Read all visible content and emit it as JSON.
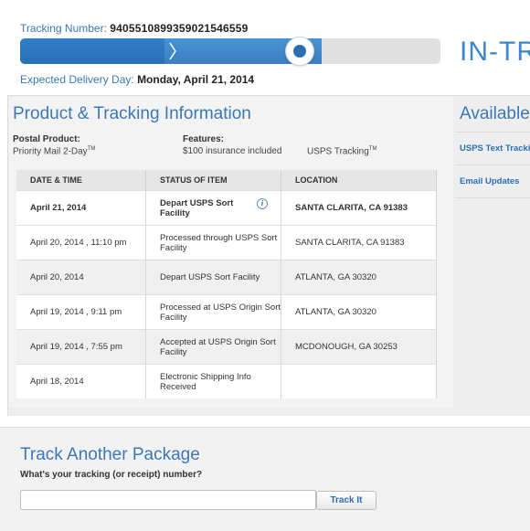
{
  "header": {
    "tracking_label": "Tracking Number:",
    "tracking_number": "9405510899359021546559",
    "status_text": "IN-TRA",
    "delivery_label": "Expected Delivery Day:",
    "delivery_value": "Monday, April 21, 2014"
  },
  "product": {
    "title": "Product & Tracking Information",
    "postal_label": "Postal Product:",
    "postal_value": "Priority Mail 2-Day",
    "postal_tm": "TM",
    "features_label": "Features:",
    "feature1": "$100 insurance included",
    "feature2": "USPS Tracking",
    "feature2_tm": "TM"
  },
  "table": {
    "headers": [
      "DATE & TIME",
      "STATUS OF ITEM",
      "LOCATION"
    ],
    "rows": [
      {
        "date": "April 21, 2014",
        "status": "Depart USPS Sort Facility",
        "location": "SANTA CLARITA, CA 91383"
      },
      {
        "date": "April 20, 2014 , 11:10 pm",
        "status": "Processed through USPS Sort Facility",
        "location": "SANTA CLARITA, CA 91383"
      },
      {
        "date": "April 20, 2014",
        "status": "Depart USPS Sort Facility",
        "location": "ATLANTA, GA 30320"
      },
      {
        "date": "April 19, 2014 , 9:11 pm",
        "status": "Processed at USPS Origin Sort Facility",
        "location": "ATLANTA, GA 30320"
      },
      {
        "date": "April 19, 2014 , 7:55 pm",
        "status": "Accepted at USPS Origin Sort Facility",
        "location": "MCDONOUGH, GA 30253"
      },
      {
        "date": "April 18, 2014",
        "status": "Electronic Shipping Info Received",
        "location": ""
      }
    ],
    "info_glyph": "i"
  },
  "sidebar": {
    "title": "Available",
    "link1": "USPS Text Tracking",
    "link2": "Email Updates"
  },
  "track_another": {
    "title": "Track Another Package",
    "question": "What's your tracking (or receipt) number?",
    "input_value": "",
    "button_label": "Track It"
  },
  "progress": {
    "stage": 2,
    "stages": 3
  },
  "colors": {
    "accent": "#3a78b7",
    "bar_fill": "#2f7fc9",
    "bar_empty": "#e0e0e0"
  }
}
